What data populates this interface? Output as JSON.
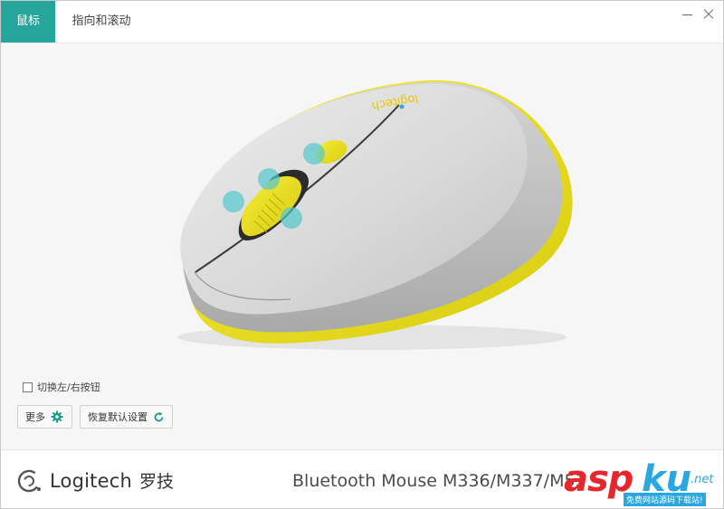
{
  "tabs": [
    {
      "label": "鼠标",
      "active": true
    },
    {
      "label": "指向和滚动",
      "active": false
    }
  ],
  "window_controls": {
    "minimize": "minimize-icon",
    "close": "close-icon"
  },
  "device": {
    "body_color": "#dcdcdc",
    "accent_color": "#f2e626",
    "logo_on_device": "logitech",
    "hotspot_color": "#57c8cc"
  },
  "options": {
    "swap_buttons_label": "切换左/右按钮",
    "swap_buttons_checked": false
  },
  "buttons": {
    "more_label": "更多",
    "more_icon": "gear-icon",
    "reset_label": "恢复默认设置",
    "reset_icon": "refresh-icon"
  },
  "footer": {
    "brand": "Logitech",
    "brand_cn": "罗技",
    "model": "Bluetooth Mouse M336/M337/M53"
  },
  "watermark": {
    "text_red": "asp",
    "text_blue": "ku",
    "suffix": ".net",
    "subtitle": "免费网站源码下载站!"
  },
  "colors": {
    "tab_active": "#26a69a",
    "accent_teal": "#1a9b8e"
  }
}
